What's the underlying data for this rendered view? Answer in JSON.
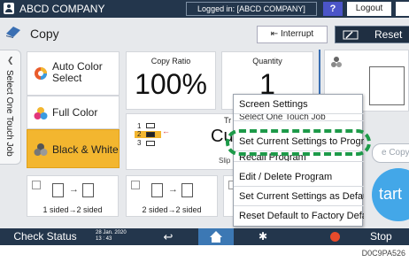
{
  "topbar": {
    "company": "ABCD COMPANY",
    "login_status": "Logged in: [ABCD COMPANY]",
    "help_label": "?",
    "logout_label": "Logout"
  },
  "app": {
    "title": "Copy",
    "interrupt_label": "Interrupt",
    "reset_label": "Reset"
  },
  "side_tab": {
    "label": "Select One Touch Job"
  },
  "color_modes": [
    {
      "label": "Auto Color Select",
      "selected": false
    },
    {
      "label": "Full Color",
      "selected": false
    },
    {
      "label": "Black & White",
      "selected": true
    }
  ],
  "copy_ratio": {
    "label": "Copy Ratio",
    "value": "100%"
  },
  "quantity": {
    "label": "Quantity",
    "value": "1"
  },
  "tray": {
    "label_partial": "Tr",
    "value_partial": "Cust",
    "sub_partial": "Slip S",
    "tray_numbers": [
      "1",
      "2",
      "3"
    ]
  },
  "duplex_options": [
    {
      "label": "1 sided→2 sided"
    },
    {
      "label": "2 sided→2 sided"
    },
    {
      "label_partial": "1"
    }
  ],
  "menu": {
    "items": [
      "Screen Settings",
      "Select One Touch Job",
      "Set Current Settings to Program",
      "Recall Program",
      "Edit / Delete Program",
      "Set Current Settings as Default",
      "Reset Default to Factory Default"
    ],
    "highlighted_item": "Set Current Settings to Program",
    "highlight_color": "#1d9a49"
  },
  "right_panel": {
    "ecopy_partial": "e Copy",
    "start_partial": "tart"
  },
  "bottombar": {
    "check_status": "Check Status",
    "date": "28 Jan. 2020",
    "time": "13 : 43",
    "stop_label": "Stop"
  },
  "footer_code": "D0C9PA526",
  "colors": {
    "bar": "#23364c",
    "active_mode": "#f3b62f",
    "home_button": "#3c78b4",
    "start_button": "#43a7e8",
    "help_button": "#4b55c8"
  }
}
